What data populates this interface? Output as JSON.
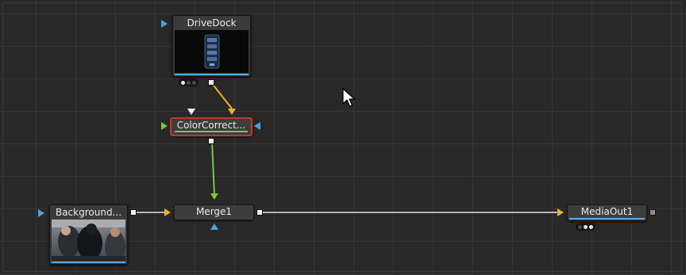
{
  "colors": {
    "canvas_bg": "#282828",
    "grid_line": "#353535",
    "node_bg": "#3d3d3d",
    "highlight_blue": "#5aa7e0",
    "wire_white": "#e6e6e6",
    "wire_yellow": "#e7b22b",
    "wire_green": "#84c040",
    "selected_border": "#c0392b"
  },
  "nodes": {
    "drivedock": {
      "title": "DriveDock",
      "has_thumbnail": true,
      "thumbnail_icon": "hard-drive-icon"
    },
    "colorcorrect": {
      "title": "ColorCorrect...",
      "selected": true
    },
    "background": {
      "title": "Background...",
      "has_thumbnail": true,
      "thumbnail_icon": "people-photo-icon"
    },
    "merge": {
      "title": "Merge1"
    },
    "mediaout": {
      "title": "MediaOut1"
    }
  },
  "connections": [
    {
      "from": "DriveDock",
      "to": "ColorCorrect...",
      "input": "yellow-background"
    },
    {
      "from": "ColorCorrect...",
      "to": "Merge1",
      "input": "green-foreground"
    },
    {
      "from": "Background...",
      "to": "Merge1",
      "input": "yellow-background"
    },
    {
      "from": "Merge1",
      "to": "MediaOut1",
      "input": "yellow-input"
    }
  ],
  "cursor_icon": "mouse-pointer-icon"
}
